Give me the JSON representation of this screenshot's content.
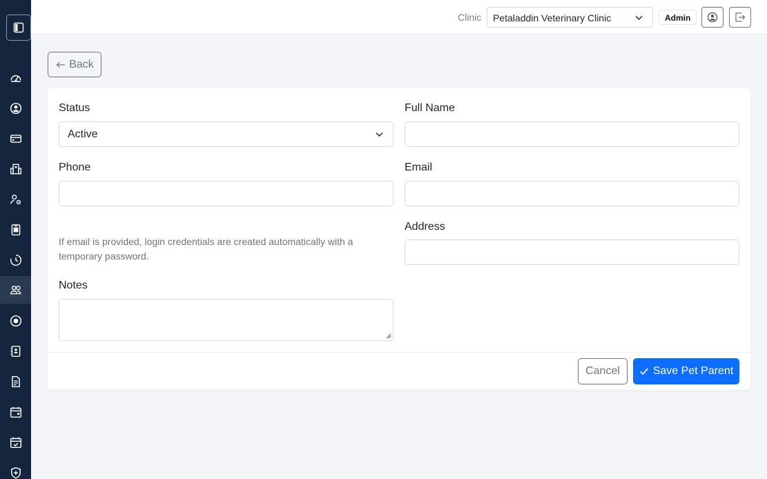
{
  "sidebar": {
    "toggle_icon": "sidebar-toggle-icon",
    "items": [
      {
        "icon": "speedometer-icon",
        "active": false
      },
      {
        "icon": "person-circle-icon",
        "active": false
      },
      {
        "icon": "credit-card-icon",
        "active": false
      },
      {
        "icon": "hospital-icon",
        "active": false
      },
      {
        "icon": "person-gear-icon",
        "active": false
      },
      {
        "icon": "id-badge-icon",
        "active": false
      },
      {
        "icon": "clock-history-icon",
        "active": false
      },
      {
        "icon": "people-icon",
        "active": true
      },
      {
        "icon": "record-circle-icon",
        "active": false
      },
      {
        "icon": "contact-list-icon",
        "active": false
      },
      {
        "icon": "file-text-icon",
        "active": false
      },
      {
        "icon": "calendar-event-icon",
        "active": false
      },
      {
        "icon": "calendar-check-icon",
        "active": false
      },
      {
        "icon": "shield-plus-icon",
        "active": false
      }
    ]
  },
  "header": {
    "clinic_label": "Clinic",
    "clinic_selected": "Petaladdin Veterinary Clinic",
    "role_badge": "Admin",
    "profile_icon": "person-circle-icon",
    "logout_icon": "box-arrow-right-icon"
  },
  "back_button": {
    "label": "Back",
    "icon": "arrow-left-icon"
  },
  "form": {
    "status": {
      "label": "Status",
      "value": "Active"
    },
    "full_name": {
      "label": "Full Name",
      "value": ""
    },
    "phone": {
      "label": "Phone",
      "value": ""
    },
    "email": {
      "label": "Email",
      "value": ""
    },
    "address": {
      "label": "Address",
      "value": ""
    },
    "help_text": "If email is provided, login credentials are created automatically with a temporary password.",
    "notes": {
      "label": "Notes",
      "value": ""
    }
  },
  "actions": {
    "cancel_label": "Cancel",
    "save_label": "Save Pet Parent",
    "save_icon": "check-icon"
  },
  "colors": {
    "sidebar_bg": "#14253d",
    "primary": "#0d6efd",
    "page_bg": "#f4f5f9"
  }
}
